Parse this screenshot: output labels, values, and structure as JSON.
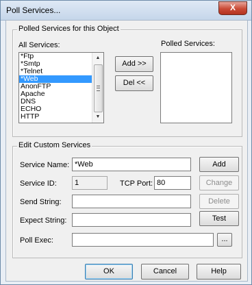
{
  "window": {
    "title": "Poll Services...",
    "close_glyph": "X"
  },
  "polled_group": {
    "legend": "Polled Services for this Object",
    "all_services_label": "All Services:",
    "polled_services_label": "Polled Services:",
    "all_services": [
      "*Ftp",
      "*Smtp",
      "*Telnet",
      "*Web",
      "AnonFTP",
      "Apache",
      "DNS",
      "ECHO",
      "HTTP"
    ],
    "selected_service": "*Web",
    "polled_services": [],
    "add_button": "Add >>",
    "del_button": "Del <<",
    "scroll_up_icon": "arrow-up-icon",
    "scroll_down_icon": "arrow-down-icon"
  },
  "custom_group": {
    "legend": "Edit Custom Services",
    "service_name_label": "Service Name:",
    "service_name_value": "*Web",
    "service_id_label": "Service ID:",
    "service_id_value": "1",
    "tcp_port_label": "TCP Port:",
    "tcp_port_value": "80",
    "send_string_label": "Send String:",
    "send_string_value": "",
    "expect_string_label": "Expect String:",
    "expect_string_value": "",
    "poll_exec_label": "Poll Exec:",
    "poll_exec_value": "",
    "add_button": "Add",
    "change_button": "Change",
    "delete_button": "Delete",
    "test_button": "Test",
    "browse_button": "..."
  },
  "footer": {
    "ok_button": "OK",
    "cancel_button": "Cancel",
    "help_button": "Help"
  }
}
